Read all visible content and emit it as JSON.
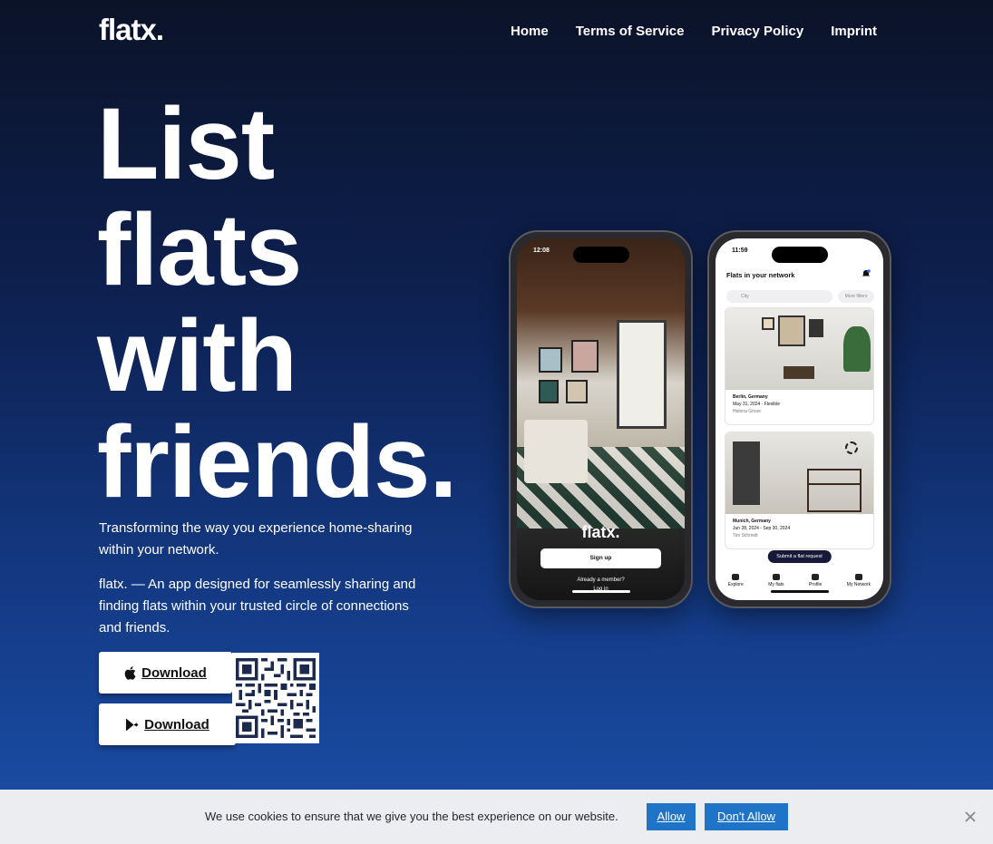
{
  "nav": {
    "logo": "flatx.",
    "links": [
      "Home",
      "Terms of Service",
      "Privacy Policy",
      "Imprint"
    ]
  },
  "hero": {
    "title_lines": [
      "List",
      "flats",
      "with",
      "friends."
    ],
    "tagline": "Transforming the way you experience home-sharing within your network.",
    "description": "flatx. — An app designed for seamlessly sharing and finding flats within your trusted circle of connections and friends.",
    "apple_button": "Download",
    "play_button": "Download"
  },
  "phone_left": {
    "time": "12:08",
    "logo": "flatx.",
    "signup": "Sign up",
    "already_member": "Already a member?",
    "login": "Log in"
  },
  "phone_right": {
    "time": "11:59",
    "title": "Flats in your network",
    "search_placeholder": "City",
    "filters": "More filters",
    "cards": [
      {
        "city": "Berlin, Germany",
        "dates": "May 31, 2024 · Flexible",
        "owner": "Helena Grose"
      },
      {
        "city": "Munich, Germany",
        "dates": "Jun 28, 2024 - Sep 30, 2024",
        "owner": "Tim Schmidt"
      }
    ],
    "submit": "Submit a flat request",
    "tabs": [
      "Explore",
      "My flats",
      "Profile",
      "My Network"
    ]
  },
  "cookie": {
    "text": "We use cookies to ensure that we give you the best experience on our website.",
    "allow": "Allow",
    "deny": "Don't Allow"
  },
  "colors": {
    "cookie_button": "#1f74c7",
    "background_top": "#0b1328",
    "background_bottom": "#1a4fa8"
  }
}
